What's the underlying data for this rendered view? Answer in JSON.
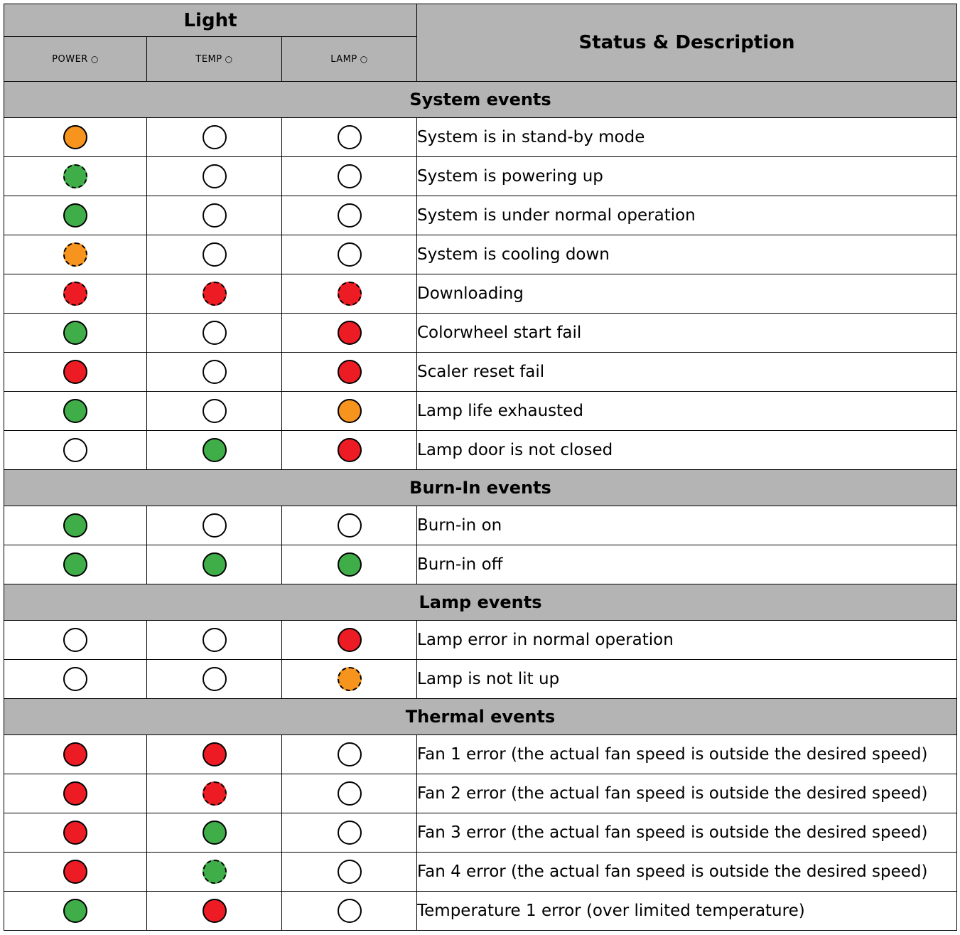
{
  "header": {
    "light": "Light",
    "status": "Status & Description",
    "columns": [
      {
        "label": "POWER",
        "circle": "○"
      },
      {
        "label": "TEMP",
        "circle": "○"
      },
      {
        "label": "LAMP",
        "circle": "○"
      }
    ]
  },
  "sections": [
    {
      "title": "System events",
      "rows": [
        {
          "power": "orange",
          "temp": "off",
          "lamp": "off",
          "desc": "System is in stand-by mode"
        },
        {
          "power": "green-flash",
          "temp": "off",
          "lamp": "off",
          "desc": "System is powering up"
        },
        {
          "power": "green",
          "temp": "off",
          "lamp": "off",
          "desc": "System is under normal operation"
        },
        {
          "power": "orange-flash",
          "temp": "off",
          "lamp": "off",
          "desc": "System is cooling down"
        },
        {
          "power": "red-flash",
          "temp": "red-flash",
          "lamp": "red-flash",
          "desc": "Downloading"
        },
        {
          "power": "green",
          "temp": "off",
          "lamp": "red",
          "desc": "Colorwheel start fail"
        },
        {
          "power": "red",
          "temp": "off",
          "lamp": "red",
          "desc": "Scaler reset fail"
        },
        {
          "power": "green",
          "temp": "off",
          "lamp": "orange",
          "desc": "Lamp life exhausted"
        },
        {
          "power": "off",
          "temp": "green",
          "lamp": "red",
          "desc": "Lamp door is not closed"
        }
      ]
    },
    {
      "title": "Burn-In events",
      "rows": [
        {
          "power": "green",
          "temp": "off",
          "lamp": "off",
          "desc": "Burn-in on"
        },
        {
          "power": "green",
          "temp": "green",
          "lamp": "green",
          "desc": "Burn-in off"
        }
      ]
    },
    {
      "title": "Lamp events",
      "rows": [
        {
          "power": "off",
          "temp": "off",
          "lamp": "red",
          "desc": "Lamp error in normal operation"
        },
        {
          "power": "off",
          "temp": "off",
          "lamp": "orange-flash",
          "desc": "Lamp is not lit up"
        }
      ]
    },
    {
      "title": "Thermal events",
      "rows": [
        {
          "power": "red",
          "temp": "red",
          "lamp": "off",
          "desc": "Fan 1 error (the actual fan speed is outside the desired speed)"
        },
        {
          "power": "red",
          "temp": "red-flash",
          "lamp": "off",
          "desc": "Fan 2 error (the actual fan speed is outside the desired speed)"
        },
        {
          "power": "red",
          "temp": "green",
          "lamp": "off",
          "desc": "Fan 3 error (the actual fan speed is outside the desired speed)"
        },
        {
          "power": "red",
          "temp": "green-flash",
          "lamp": "off",
          "desc": "Fan 4 error (the actual fan speed is outside the desired speed)"
        },
        {
          "power": "green",
          "temp": "red",
          "lamp": "off",
          "desc": "Temperature 1 error (over limited temperature)"
        }
      ]
    }
  ],
  "colors": {
    "orange": "#f7941d",
    "green": "#3fae49",
    "red": "#ed1c24",
    "header_bg": "#b4b4b4"
  }
}
